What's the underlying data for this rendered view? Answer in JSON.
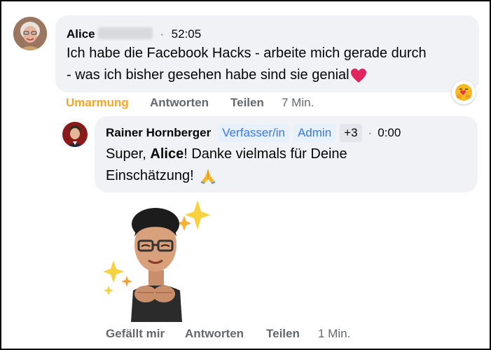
{
  "comment": {
    "author": "Alice",
    "time": "52:05",
    "text_line1": "Ich habe die Facebook Hacks - arbeite mich gerade durch",
    "text_line2": "- was ich bisher gesehen habe sind sie genial",
    "reaction_emoji": "hug-emoji",
    "actions": {
      "reaction_label": "Umarmung",
      "reply_label": "Antworten",
      "share_label": "Teilen",
      "age": "7 Min."
    }
  },
  "reply": {
    "author": "Rainer Hornberger",
    "badge_author": "Verfasser/in",
    "badge_admin": "Admin",
    "badge_more": "+3",
    "time": "0:00",
    "text_prefix": "Super, ",
    "text_mention": "Alice",
    "text_line1_rest": "! Danke vielmals für Deine",
    "text_line2": "Einschätzung!",
    "sticker": "avatar-sticker-thankful",
    "actions": {
      "like_label": "Gefällt mir",
      "reply_label": "Antworten",
      "share_label": "Teilen",
      "age": "1 Min."
    }
  },
  "colors": {
    "bubble": "#f0f2f5",
    "reaction_hug": "#f5a623",
    "badge_text": "#3578e5",
    "meta": "#65676b"
  }
}
